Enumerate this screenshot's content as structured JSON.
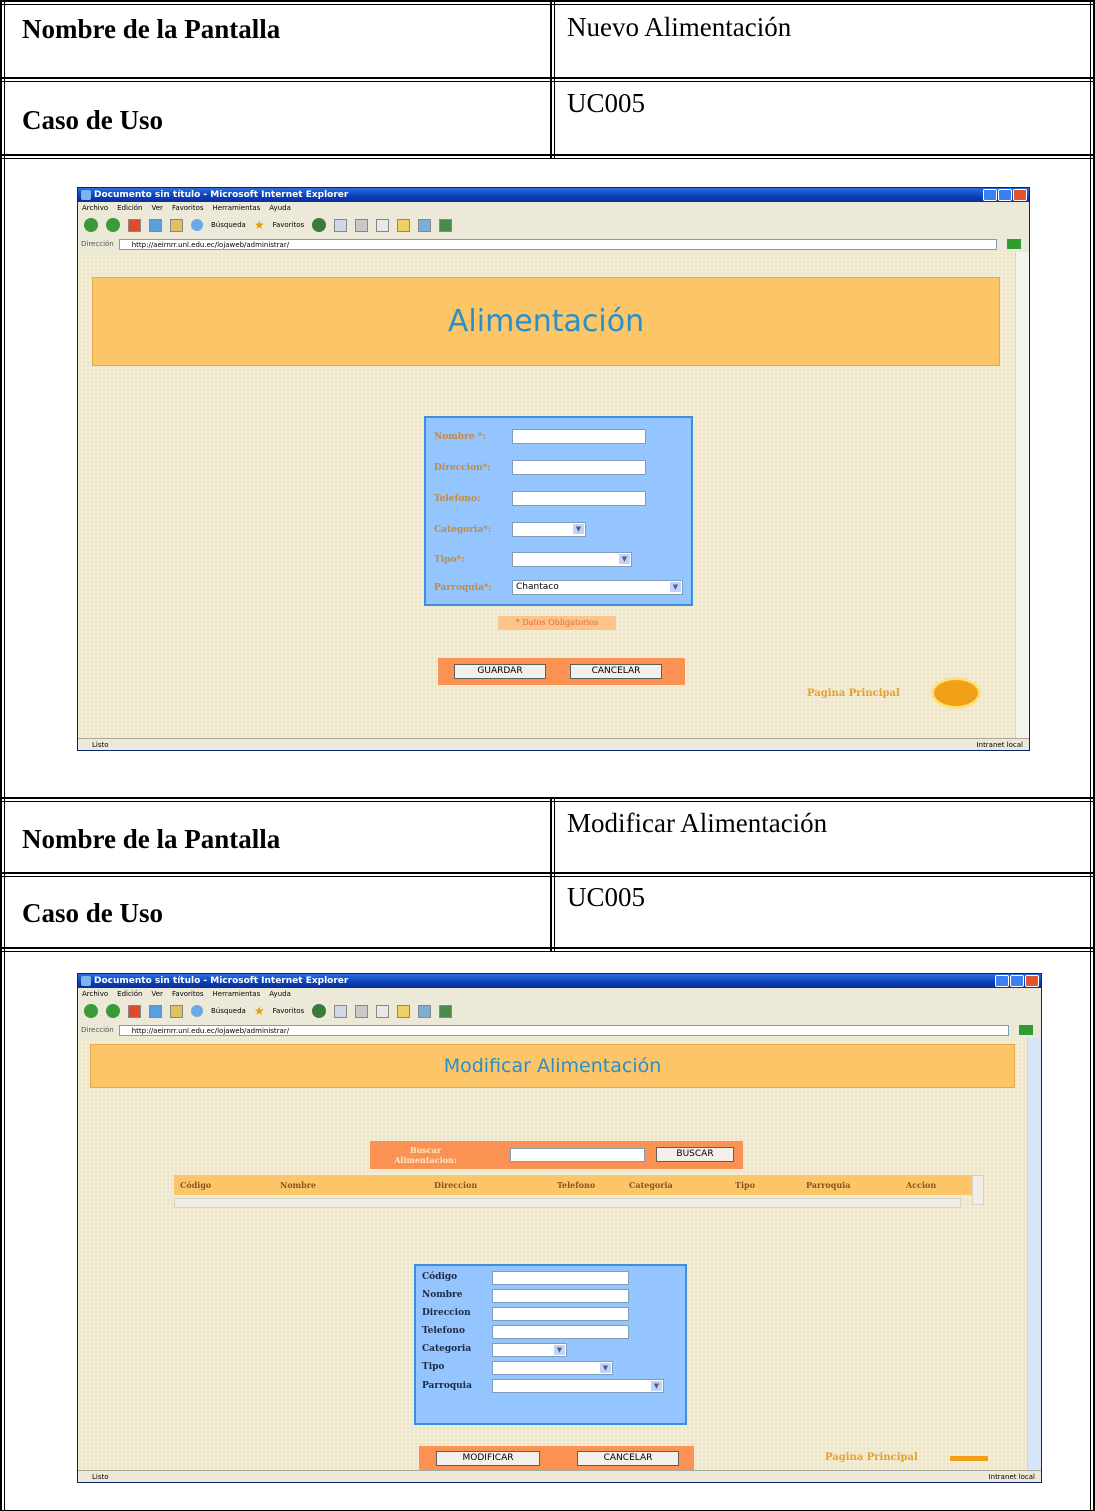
{
  "sections": [
    {
      "screen_name_label": "Nombre de la Pantalla",
      "screen_name_value": "Nuevo Alimentación",
      "use_case_label": "Caso de Uso",
      "use_case_value": "UC005"
    },
    {
      "screen_name_label": "Nombre de la Pantalla",
      "screen_name_value": "Modificar Alimentación",
      "use_case_label": "Caso de Uso",
      "use_case_value": "UC005"
    }
  ],
  "browser": {
    "title": "Documento sin título - Microsoft Internet Explorer",
    "menu": [
      "Archivo",
      "Edición",
      "Ver",
      "Favoritos",
      "Herramientas",
      "Ayuda"
    ],
    "address_label": "Dirección",
    "url": "http://aeirnrr.unl.edu.ec/lojaweb/administrar/",
    "search_label": "Búsqueda",
    "favorites_label": "Favoritos",
    "status_left": "Listo",
    "status_right": "Intranet local"
  },
  "screen1": {
    "banner_title": "Alimentación",
    "fields": [
      {
        "label": "Nombre *:"
      },
      {
        "label": "Direccion*:"
      },
      {
        "label": "Telefono:"
      },
      {
        "label": "Categoria*:"
      },
      {
        "label": "Tipo*:"
      },
      {
        "label": "Parroquia*:",
        "value": "Chantaco"
      }
    ],
    "required_note": "* Datos Obligatorios",
    "save_label": "GUARDAR",
    "cancel_label": "CANCELAR",
    "home_link": "Pagina Principal"
  },
  "screen2": {
    "banner_title": "Modificar Alimentación",
    "search_label": "Buscar Alimentacion:",
    "search_button": "BUSCAR",
    "columns": [
      "Código",
      "Nombre",
      "Direccion",
      "Telefono",
      "Categoria",
      "Tipo",
      "Parroquia",
      "Accion"
    ],
    "fields": [
      "Código",
      "Nombre",
      "Direccion",
      "Telefono",
      "Categoria",
      "Tipo",
      "Parroquia"
    ],
    "modify_label": "MODIFICAR",
    "cancel_label": "CANCELAR",
    "home_link": "Pagina Principal"
  }
}
